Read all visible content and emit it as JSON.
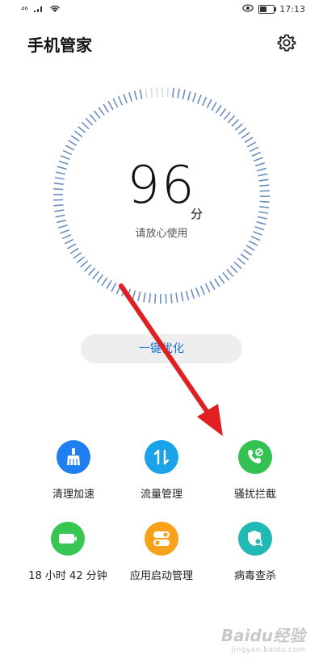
{
  "status_bar": {
    "signal": "⁴⁶",
    "time": "17:13",
    "battery_level": 0.5
  },
  "app": {
    "title": "手机管家"
  },
  "score": {
    "value": "96",
    "unit": "分",
    "status": "请放心使用",
    "fraction": 0.96
  },
  "optimize_label": "一键优化",
  "tools": [
    {
      "label": "清理加速",
      "icon": "broom-icon",
      "color": "#1f7ff0"
    },
    {
      "label": "流量管理",
      "icon": "data-arrows-icon",
      "color": "#1aa3e8"
    },
    {
      "label": "骚扰拦截",
      "icon": "phone-block-icon",
      "color": "#33c152"
    },
    {
      "label": "18 小时 42 分钟",
      "icon": "battery-icon",
      "color": "#38c652"
    },
    {
      "label": "应用启动管理",
      "icon": "toggle-icon",
      "color": "#f7a21a"
    },
    {
      "label": "病毒查杀",
      "icon": "shield-scan-icon",
      "color": "#22b8b4"
    }
  ],
  "watermark": {
    "logo": "Baidu经验",
    "url": "jingyan.baidu.com"
  },
  "colors": {
    "dial_tick": "#6b8fbf",
    "dial_tick_faded": "#d6dde8",
    "accent_blue": "#1a70d8",
    "arrow_red": "#e02020"
  }
}
